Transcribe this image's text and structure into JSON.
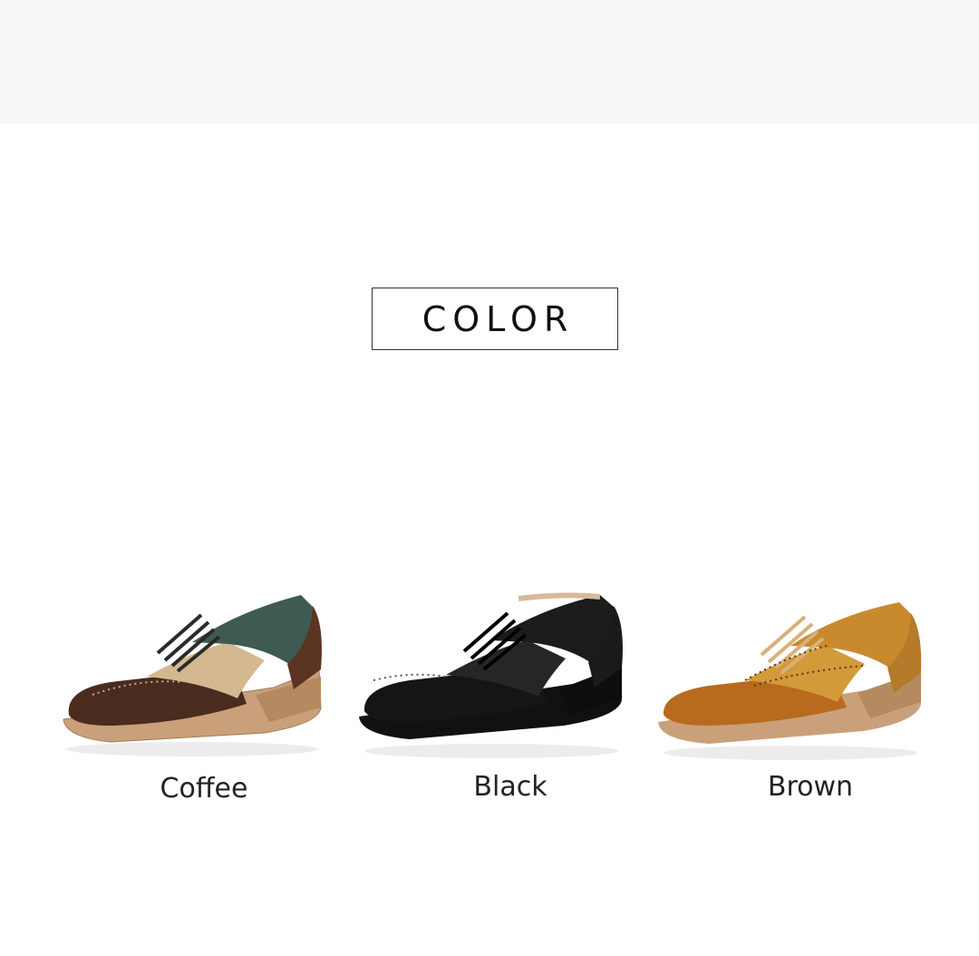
{
  "section": {
    "title": "COLOR"
  },
  "variants": [
    {
      "label": "Coffee",
      "colors": {
        "toe": "#4a2c1f",
        "quarter": "#3f5a52",
        "wing": "#d4b88f",
        "heel": "#5b3424",
        "sole": "#c9a07a"
      }
    },
    {
      "label": "Black",
      "colors": {
        "toe": "#151515",
        "quarter": "#1c1c1c",
        "wing": "#262626",
        "heel": "#1a1a1a",
        "sole": "#111111"
      }
    },
    {
      "label": "Brown",
      "colors": {
        "toe": "#b86a1e",
        "quarter": "#c98a2e",
        "wing": "#d39a3a",
        "heel": "#b57a2a",
        "sole": "#c9a07a"
      }
    }
  ],
  "page": {
    "background": "#ffffff",
    "top_band": "#f6f6f6"
  }
}
